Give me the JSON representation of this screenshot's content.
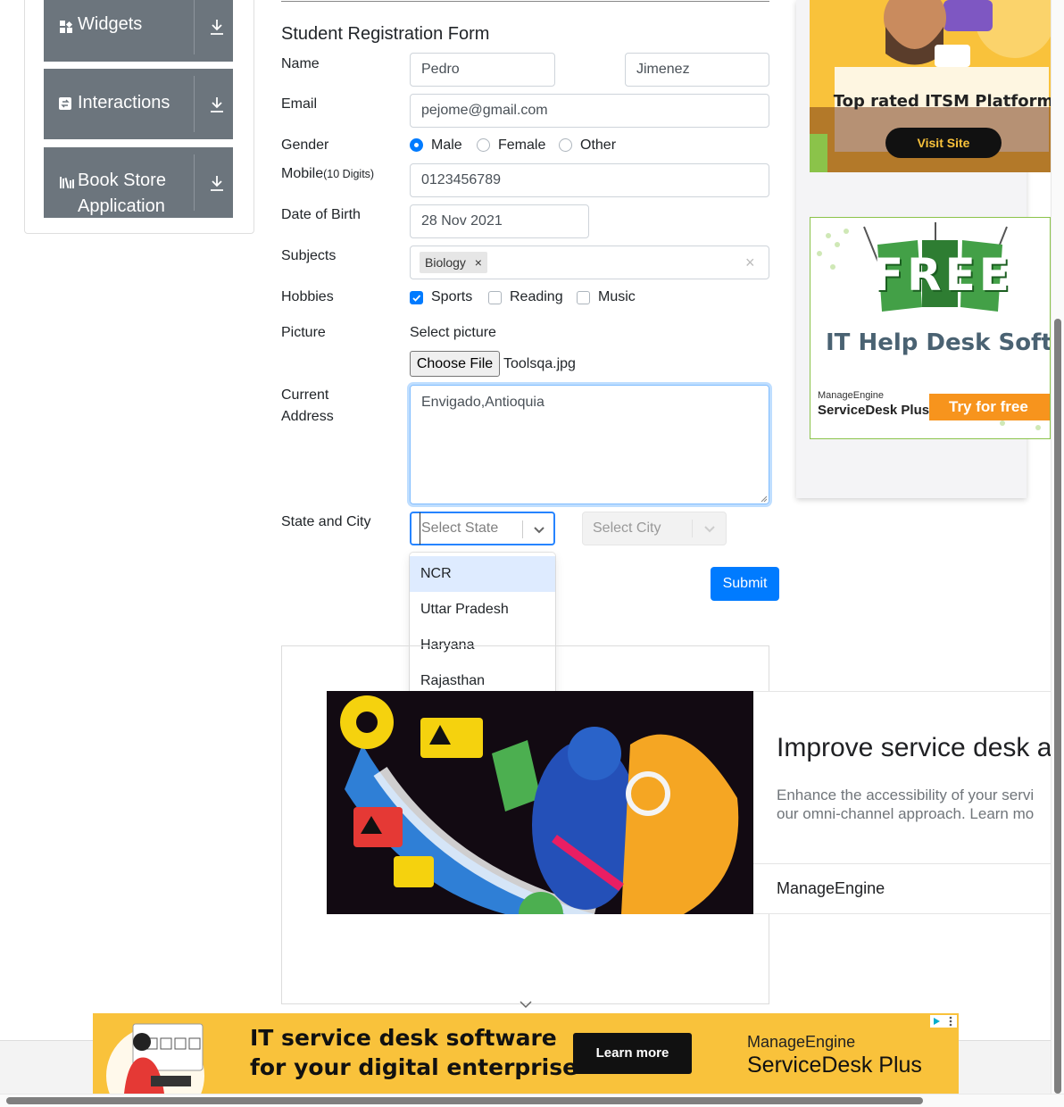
{
  "sidebar": {
    "groups": [
      {
        "label": "Widgets",
        "icon": "widgets-icon"
      },
      {
        "label": "Interactions",
        "icon": "interactions-icon"
      },
      {
        "label": "Book Store",
        "label2": "Application",
        "icon": "book-store-icon"
      }
    ]
  },
  "form": {
    "title": "Student Registration Form",
    "name_label": "Name",
    "first_name": "Pedro",
    "last_name": "Jimenez",
    "email_label": "Email",
    "email": "pejome@gmail.com",
    "gender_label": "Gender",
    "gender_options": [
      "Male",
      "Female",
      "Other"
    ],
    "gender_selected": "Male",
    "mobile_label": "Mobile",
    "mobile_hint": "(10 Digits)",
    "mobile": "0123456789",
    "dob_label": "Date of Birth",
    "dob": "28 Nov 2021",
    "subjects_label": "Subjects",
    "subjects": [
      "Biology"
    ],
    "subject_remove": "×",
    "subjects_clear": "×",
    "hobbies_label": "Hobbies",
    "hobbies": [
      {
        "label": "Sports",
        "checked": true
      },
      {
        "label": "Reading",
        "checked": false
      },
      {
        "label": "Music",
        "checked": false
      }
    ],
    "picture_label": "Picture",
    "picture_hint": "Select picture",
    "choose_file": "Choose File",
    "file_name": "Toolsqa.jpg",
    "address_label_1": "Current",
    "address_label_2": "Address",
    "address": "Envigado,Antioquia",
    "state_city_label": "State and City",
    "state_placeholder": "Select State",
    "city_placeholder": "Select City",
    "state_options": [
      "NCR",
      "Uttar Pradesh",
      "Haryana",
      "Rajasthan"
    ],
    "state_highlighted": "NCR",
    "submit": "Submit"
  },
  "ads": {
    "itsm": {
      "headline": "Top rated ITSM Platform",
      "cta": "Visit Site"
    },
    "free": {
      "badge": "FREE",
      "headline": "IT Help Desk Softwar",
      "brand_top": "ManageEngine",
      "brand_bottom": "ServiceDesk Plus",
      "cta": "Try for free"
    },
    "service": {
      "headline": "Improve service desk a",
      "body_1": "Enhance the accessibility of your servi",
      "body_2": "our omni-channel approach. Learn mo",
      "brand": "ManageEngine"
    },
    "banner": {
      "line1": "IT service desk software",
      "line2": "for your digital enterprise",
      "cta": "Learn more",
      "brand_top": "ManageEngine",
      "brand_bottom": "ServiceDesk Plus"
    }
  },
  "colors": {
    "primary": "#007bff",
    "sidebar": "#6c757d",
    "ad_yellow": "#f9c23b",
    "ad_orange": "#f7941d"
  }
}
